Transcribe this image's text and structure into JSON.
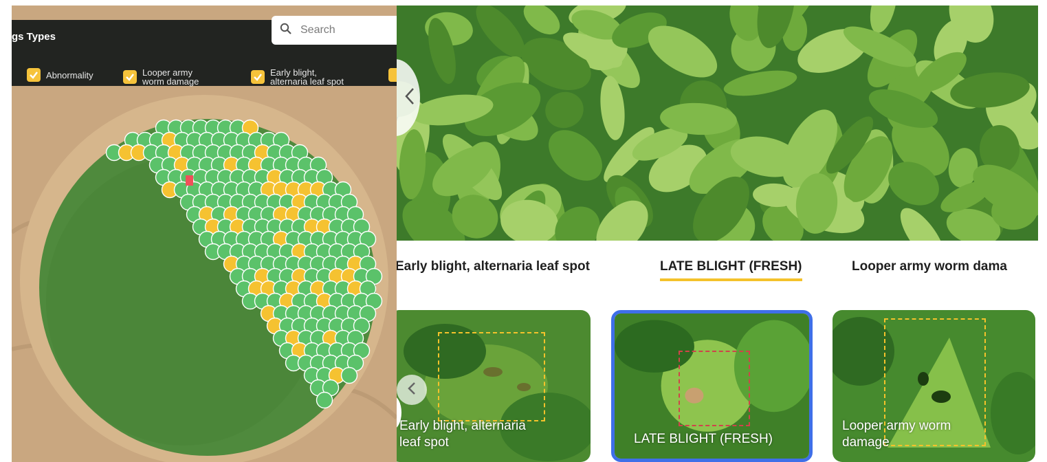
{
  "legend": {
    "title": "gs Types",
    "items": [
      {
        "label": "Abnormality"
      },
      {
        "label": "Looper army\nworm damage"
      },
      {
        "label": "Early blight,\nalternaria leaf spot"
      }
    ]
  },
  "search": {
    "placeholder": "Search"
  },
  "tabs": [
    {
      "label": "Early blight, alternaria leaf spot",
      "active": false
    },
    {
      "label": "LATE BLIGHT (FRESH)",
      "active": true
    },
    {
      "label": "Looper army worm dama",
      "active": false
    }
  ],
  "thumbnails": [
    {
      "caption": "Early blight, alternaria\nleaf spot",
      "selected": false
    },
    {
      "caption": "LATE BLIGHT (FRESH)",
      "selected": true
    },
    {
      "caption": "Looper army worm\ndamage",
      "selected": false
    }
  ],
  "colors": {
    "healthy": "#5bc26a",
    "warning": "#f5c231",
    "critical": "#f0505a",
    "accent": "#f4c22b",
    "selection": "#3f6fe8"
  },
  "icons": {
    "search": "search-icon",
    "check": "check-icon",
    "prev": "chevron-left-icon"
  }
}
